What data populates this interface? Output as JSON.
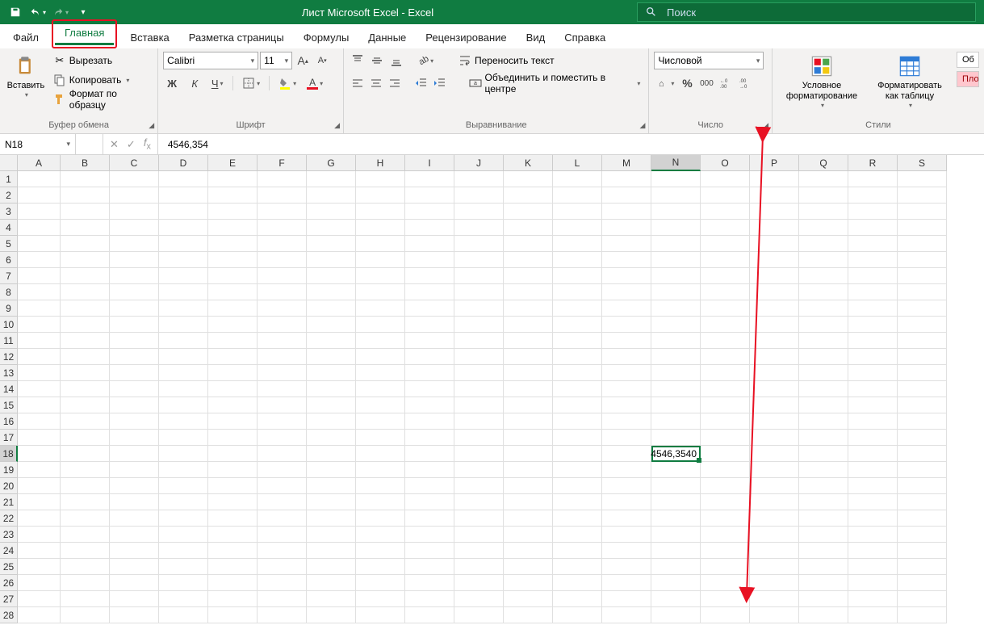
{
  "title": "Лист Microsoft Excel  -  Excel",
  "search_placeholder": "Поиск",
  "tabs": {
    "file": "Файл",
    "home": "Главная",
    "insert": "Вставка",
    "pagelayout": "Разметка страницы",
    "formulas": "Формулы",
    "data": "Данные",
    "review": "Рецензирование",
    "view": "Вид",
    "help": "Справка"
  },
  "ribbon": {
    "clipboard": {
      "paste": "Вставить",
      "cut": "Вырезать",
      "copy": "Копировать",
      "format_painter": "Формат по образцу",
      "label": "Буфер обмена"
    },
    "font": {
      "name": "Calibri",
      "size": "11",
      "label": "Шрифт"
    },
    "alignment": {
      "wrap": "Переносить текст",
      "merge": "Объединить и поместить в центре",
      "label": "Выравнивание"
    },
    "number": {
      "format": "Числовой",
      "label": "Число"
    },
    "styles": {
      "cond_format": "Условное\nформатирование",
      "format_table": "Форматировать\nкак таблицу",
      "cell_styles_partial1": "Об",
      "cell_styles_partial2": "Пло",
      "label": "Стили"
    }
  },
  "namebox": "N18",
  "formula": "4546,354",
  "columns": [
    "A",
    "B",
    "C",
    "D",
    "E",
    "F",
    "G",
    "H",
    "I",
    "J",
    "K",
    "L",
    "M",
    "N",
    "O",
    "P",
    "Q",
    "R",
    "S"
  ],
  "active_col": "N",
  "active_row": 18,
  "num_rows": 28,
  "selected_cell_value": "4546,3540"
}
